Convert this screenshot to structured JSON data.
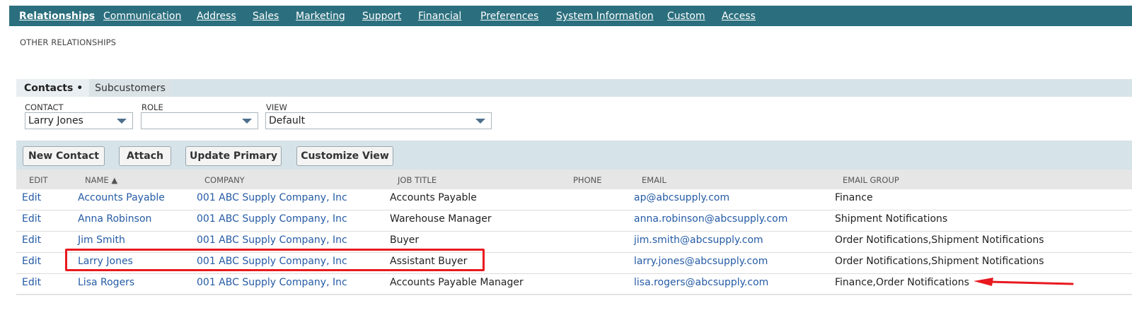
{
  "topnav": {
    "tabs": [
      {
        "label": "Relationships",
        "active": true
      },
      {
        "label": "Communication",
        "active": false
      },
      {
        "label": "Address",
        "active": false
      },
      {
        "label": "Sales",
        "active": false
      },
      {
        "label": "Marketing",
        "active": false
      },
      {
        "label": "Support",
        "active": false
      },
      {
        "label": "Financial",
        "active": false
      },
      {
        "label": "Preferences",
        "active": false
      },
      {
        "label": "System Information",
        "active": false
      },
      {
        "label": "Custom",
        "active": false
      },
      {
        "label": "Access",
        "active": false
      }
    ]
  },
  "section": {
    "title": "OTHER RELATIONSHIPS"
  },
  "subtabs": {
    "active_label": "Contacts •",
    "other_label": "Subcustomers"
  },
  "filters": {
    "contact": {
      "label": "CONTACT",
      "value": "Larry Jones"
    },
    "role": {
      "label": "ROLE",
      "value": ""
    },
    "view": {
      "label": "VIEW",
      "value": "Default"
    }
  },
  "buttons": {
    "new_contact": "New Contact",
    "attach": "Attach",
    "update_primary": "Update Primary",
    "customize_view": "Customize View"
  },
  "table": {
    "headers": {
      "edit": "EDIT",
      "name": "NAME ▲",
      "company": "COMPANY",
      "job_title": "JOB TITLE",
      "phone": "PHONE",
      "email": "EMAIL",
      "email_group": "EMAIL GROUP"
    },
    "rows": [
      {
        "edit": "Edit",
        "name": "Accounts Payable",
        "company": "001 ABC Supply Company, Inc",
        "job_title": "Accounts Payable",
        "phone": "",
        "email": "ap@abcsupply.com",
        "email_group": "Finance"
      },
      {
        "edit": "Edit",
        "name": "Anna Robinson",
        "company": "001 ABC Supply Company, Inc",
        "job_title": "Warehouse Manager",
        "phone": "",
        "email": "anna.robinson@abcsupply.com",
        "email_group": "Shipment Notifications"
      },
      {
        "edit": "Edit",
        "name": "Jim Smith",
        "company": "001 ABC Supply Company, Inc",
        "job_title": "Buyer",
        "phone": "",
        "email": "jim.smith@abcsupply.com",
        "email_group": "Order Notifications,Shipment Notifications"
      },
      {
        "edit": "Edit",
        "name": "Larry Jones",
        "company": "001 ABC Supply Company, Inc",
        "job_title": "Assistant Buyer",
        "phone": "",
        "email": "larry.jones@abcsupply.com",
        "email_group": "Order Notifications,Shipment Notifications"
      },
      {
        "edit": "Edit",
        "name": "Lisa Rogers",
        "company": "001 ABC Supply Company, Inc",
        "job_title": "Accounts Payable Manager",
        "phone": "",
        "email": "lisa.rogers@abcsupply.com",
        "email_group": "Finance,Order Notifications"
      }
    ]
  },
  "annotations": {
    "highlight_color": "#e8191f",
    "arrow_color": "#e8191f"
  },
  "colors": {
    "nav_bg": "#2b6f7e",
    "band_bg": "#d6e3e8",
    "link": "#255ba5"
  }
}
